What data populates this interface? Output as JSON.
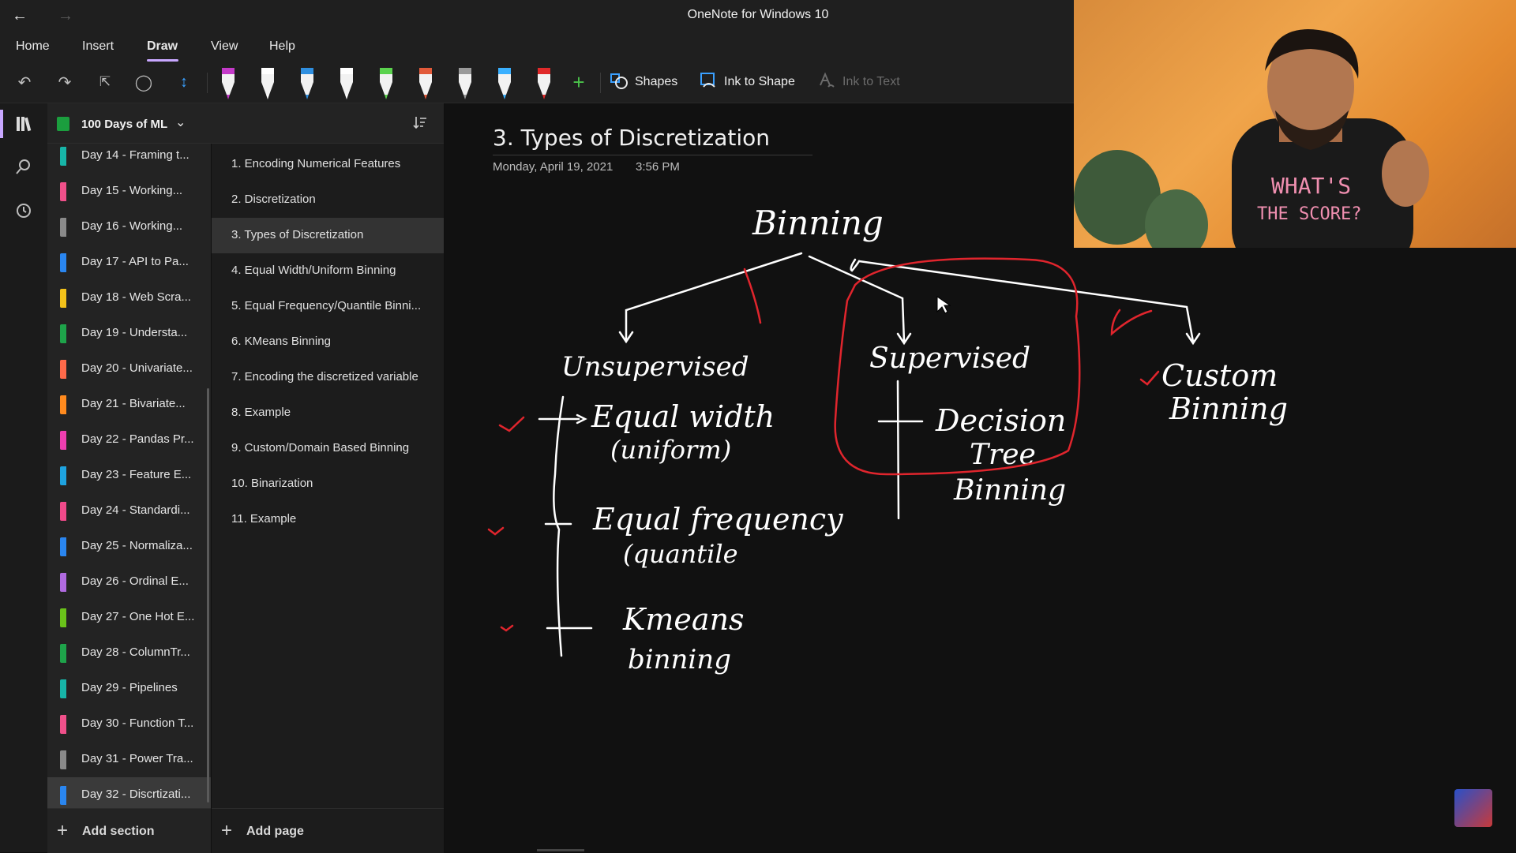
{
  "window": {
    "title": "OneNote for Windows 10",
    "back_icon": "back-arrow-icon",
    "forward_icon": "forward-arrow-icon"
  },
  "menu": {
    "items": [
      "Home",
      "Insert",
      "Draw",
      "View",
      "Help"
    ],
    "active": "Draw"
  },
  "toolbar": {
    "pen_colors": [
      "#c43ac9",
      "#ffffff",
      "#2f8fe0",
      "#ffffff",
      "#5bd34e",
      "#e25a3a",
      "#9a9a9a",
      "#3ab0ff",
      "#e02a2a"
    ],
    "shapes_label": "Shapes",
    "ink_to_shape_label": "Ink to Shape",
    "ink_to_text_label": "Ink to Text",
    "accent": "#c8a7ff"
  },
  "notebook": {
    "name": "100 Days of ML",
    "sections": [
      {
        "label": "Day 14 - Framing t...",
        "color": "#17b5a8"
      },
      {
        "label": "Day 15 - Working...",
        "color": "#f0508a"
      },
      {
        "label": "Day 16 - Working...",
        "color": "#8a8a8a"
      },
      {
        "label": "Day 17 - API to Pa...",
        "color": "#2a86f0"
      },
      {
        "label": "Day 18 - Web Scra...",
        "color": "#f3c21a"
      },
      {
        "label": "Day 19 - Understa...",
        "color": "#1ea34a"
      },
      {
        "label": "Day 20 - Univariate...",
        "color": "#ff6a4a"
      },
      {
        "label": "Day 21 - Bivariate...",
        "color": "#ff8a1e"
      },
      {
        "label": "Day 22 - Pandas Pr...",
        "color": "#ee3eb0"
      },
      {
        "label": "Day 23 - Feature E...",
        "color": "#1ea3e0"
      },
      {
        "label": "Day 24 - Standardi...",
        "color": "#f04a8a"
      },
      {
        "label": "Day 25 - Normaliza...",
        "color": "#2a86f0"
      },
      {
        "label": "Day 26 - Ordinal E...",
        "color": "#b06ae0"
      },
      {
        "label": "Day 27 - One Hot E...",
        "color": "#6ac21a"
      },
      {
        "label": "Day 28 - ColumnTr...",
        "color": "#1ea34a"
      },
      {
        "label": "Day 29 - Pipelines",
        "color": "#17b5a8"
      },
      {
        "label": "Day 30 - Function T...",
        "color": "#f0508a"
      },
      {
        "label": "Day 31 - Power Tra...",
        "color": "#8a8a8a"
      },
      {
        "label": "Day 32 - Discrtizati...",
        "color": "#2a86f0"
      }
    ],
    "selected_section": 18,
    "add_section_label": "Add section"
  },
  "pages": {
    "items": [
      "1. Encoding Numerical Features",
      "2. Discretization",
      "3. Types of Discretization",
      "4. Equal Width/Uniform Binning",
      "5. Equal Frequency/Quantile Binni...",
      "6. KMeans Binning",
      "7. Encoding the discretized variable",
      "8. Example",
      "9. Custom/Domain Based Binning",
      "10. Binarization",
      "11. Example"
    ],
    "selected_page": 2,
    "add_page_label": "Add page"
  },
  "page": {
    "title": "3. Types of Discretization",
    "date": "Monday, April 19, 2021",
    "time": "3:56 PM"
  },
  "ink": {
    "root": "Binning",
    "unsupervised": {
      "heading": "Unsupervised",
      "items": [
        [
          "Equal width",
          "(uniform)"
        ],
        [
          "Equal frequency",
          "(quantile"
        ],
        [
          "Kmeans",
          "binning"
        ]
      ]
    },
    "supervised": {
      "heading": "Supervised",
      "items": [
        [
          "Decision",
          "Tree",
          "Binning"
        ]
      ]
    },
    "custom": {
      "lines": [
        "Custom",
        "Binning"
      ]
    },
    "ink_color": "#ffffff",
    "highlight_color": "#e0252d"
  },
  "webcam": {
    "shirt_text": [
      "WHAT'S",
      "THE SCORE?"
    ]
  }
}
